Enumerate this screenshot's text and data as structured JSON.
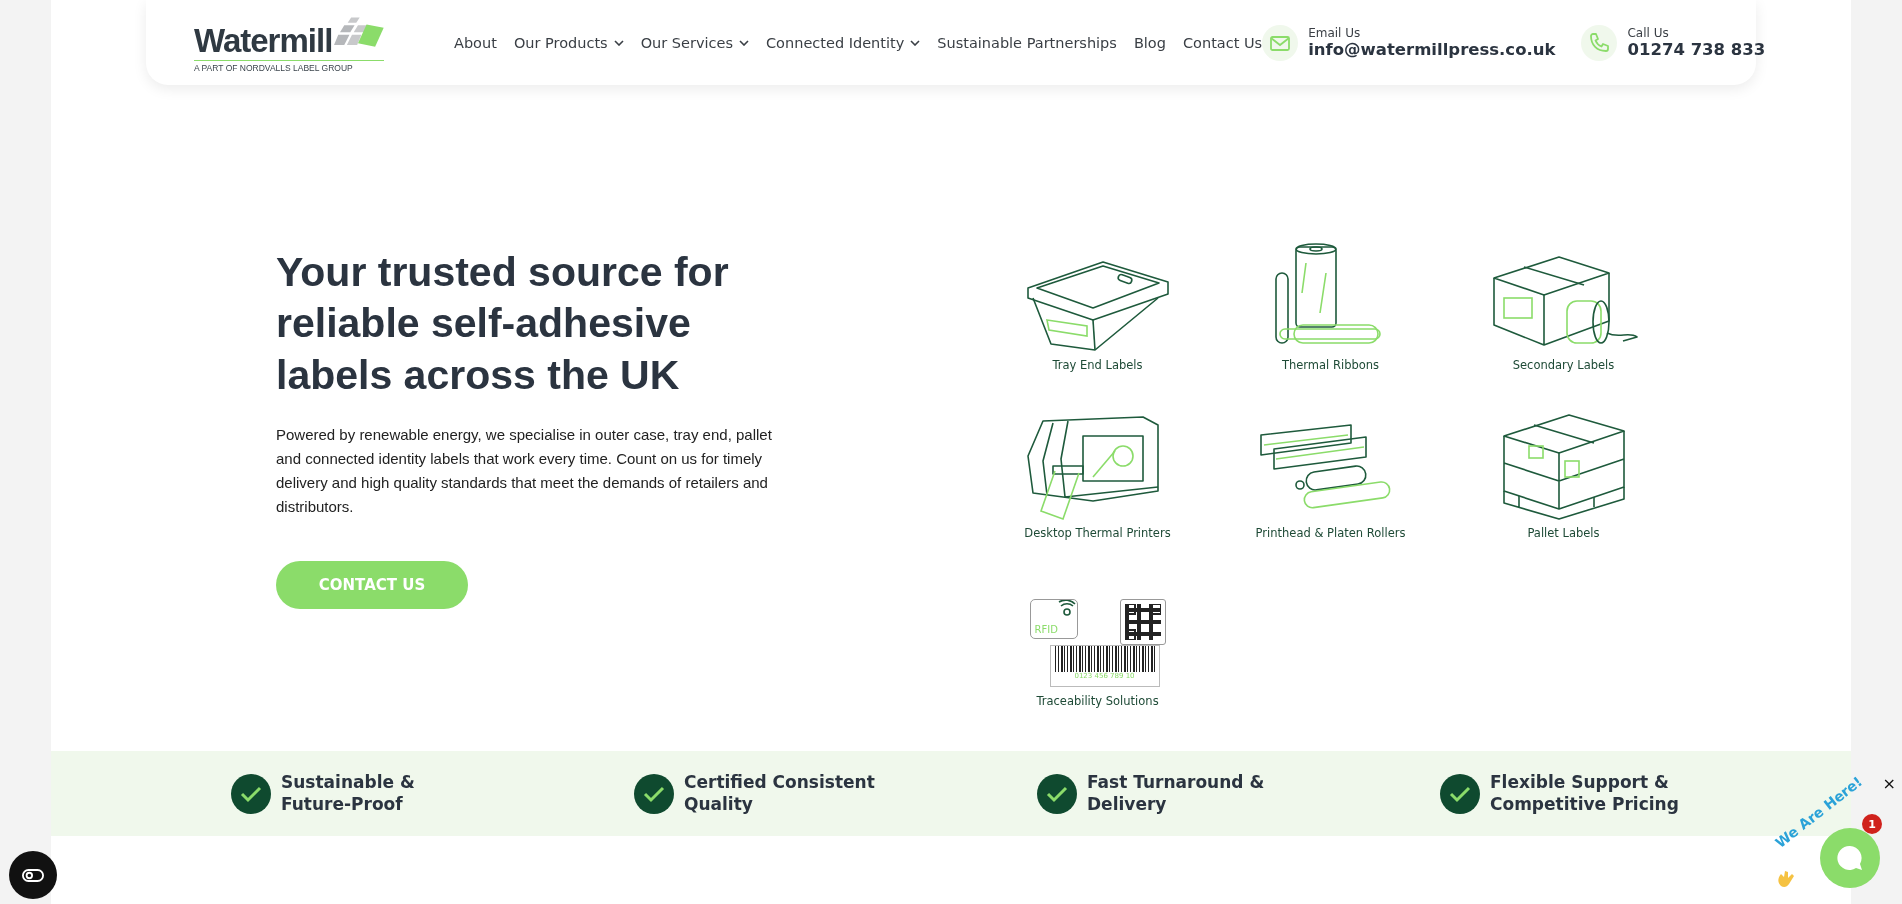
{
  "header": {
    "logo": {
      "name": "Watermill",
      "tagline": "A PART OF NORDVALLS LABEL GROUP"
    },
    "nav": [
      {
        "label": "About",
        "dropdown": false
      },
      {
        "label": "Our Products",
        "dropdown": true
      },
      {
        "label": "Our Services",
        "dropdown": true
      },
      {
        "label": "Connected Identity",
        "dropdown": true
      },
      {
        "label": "Sustainable Partnerships",
        "dropdown": false
      },
      {
        "label": "Blog",
        "dropdown": false
      },
      {
        "label": "Contact Us",
        "dropdown": false
      }
    ],
    "contacts": [
      {
        "kind": "email",
        "label": "Email Us",
        "value": "info@watermillpress.co.uk"
      },
      {
        "kind": "phone",
        "label": "Call Us",
        "value": "01274 738 833"
      }
    ]
  },
  "hero": {
    "heading": "Your trusted source for reliable self-adhesive labels across the UK",
    "text": "Powered by renewable energy, we specialise in outer case, tray end, pallet and connected identity labels that work every time. Count on us for timely delivery and high quality standards that meet the demands of retailers and distributors.",
    "button": "CONTACT US"
  },
  "products": [
    {
      "label": "Tray End Labels"
    },
    {
      "label": "Thermal Ribbons"
    },
    {
      "label": "Secondary Labels"
    },
    {
      "label": "Desktop Thermal Printers"
    },
    {
      "label": "Printhead & Platen Rollers"
    },
    {
      "label": "Pallet Labels"
    },
    {
      "label": "Traceability Solutions",
      "tag": "RFID",
      "code": "0123 456 789 10"
    }
  ],
  "features": [
    {
      "title": "Sustainable & Future-Proof"
    },
    {
      "title": "Certified Consistent Quality"
    },
    {
      "title": "Fast Turnaround & Delivery"
    },
    {
      "title": "Flexible Support & Competitive Pricing"
    }
  ],
  "chat": {
    "greeting": "We Are Here!",
    "unread": "1",
    "close": "×"
  }
}
